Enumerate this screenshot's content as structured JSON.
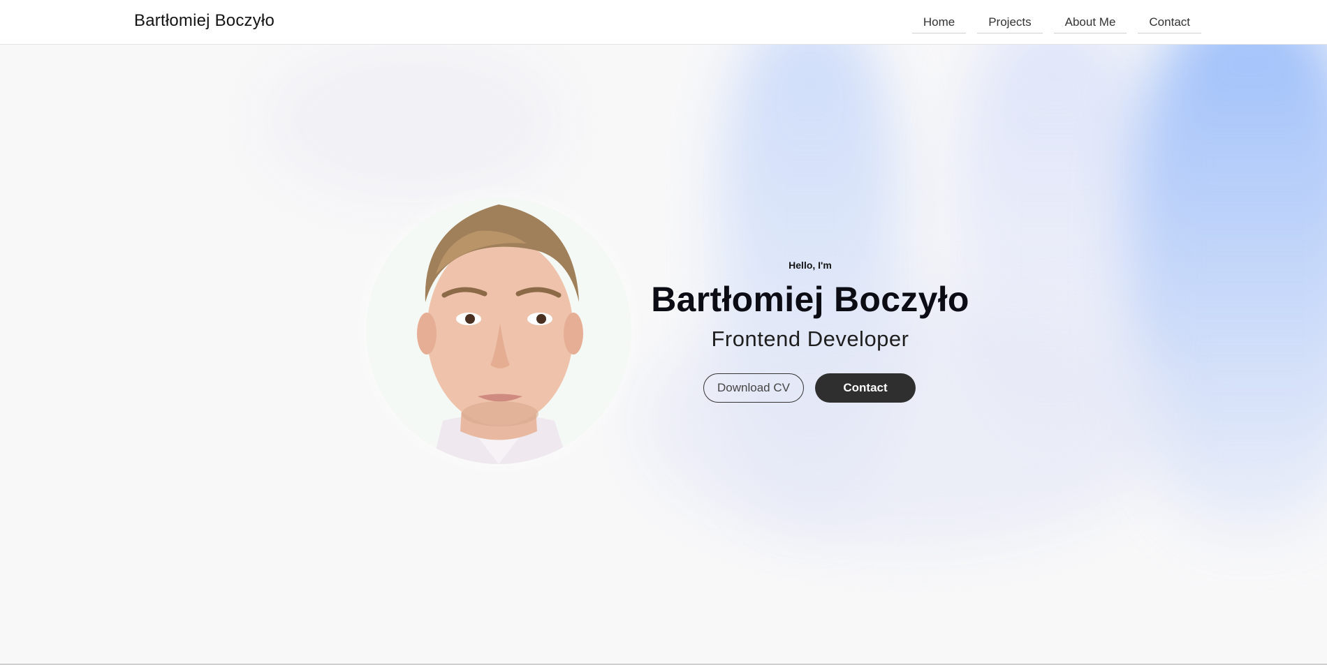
{
  "header": {
    "brand": "Bartłomiej Boczyło",
    "nav": [
      "Home",
      "Projects",
      "About Me",
      "Contact"
    ]
  },
  "hero": {
    "greeting": "Hello, I'm",
    "name": "Bartłomiej Boczyło",
    "role": "Frontend Developer",
    "download_cv_label": "Download CV",
    "contact_label": "Contact"
  },
  "colors": {
    "header_bg": "#ffffff",
    "page_bg": "#f8f8f9",
    "accent_glow": "#8cb4fa",
    "button_dark": "#2f2f2f"
  }
}
